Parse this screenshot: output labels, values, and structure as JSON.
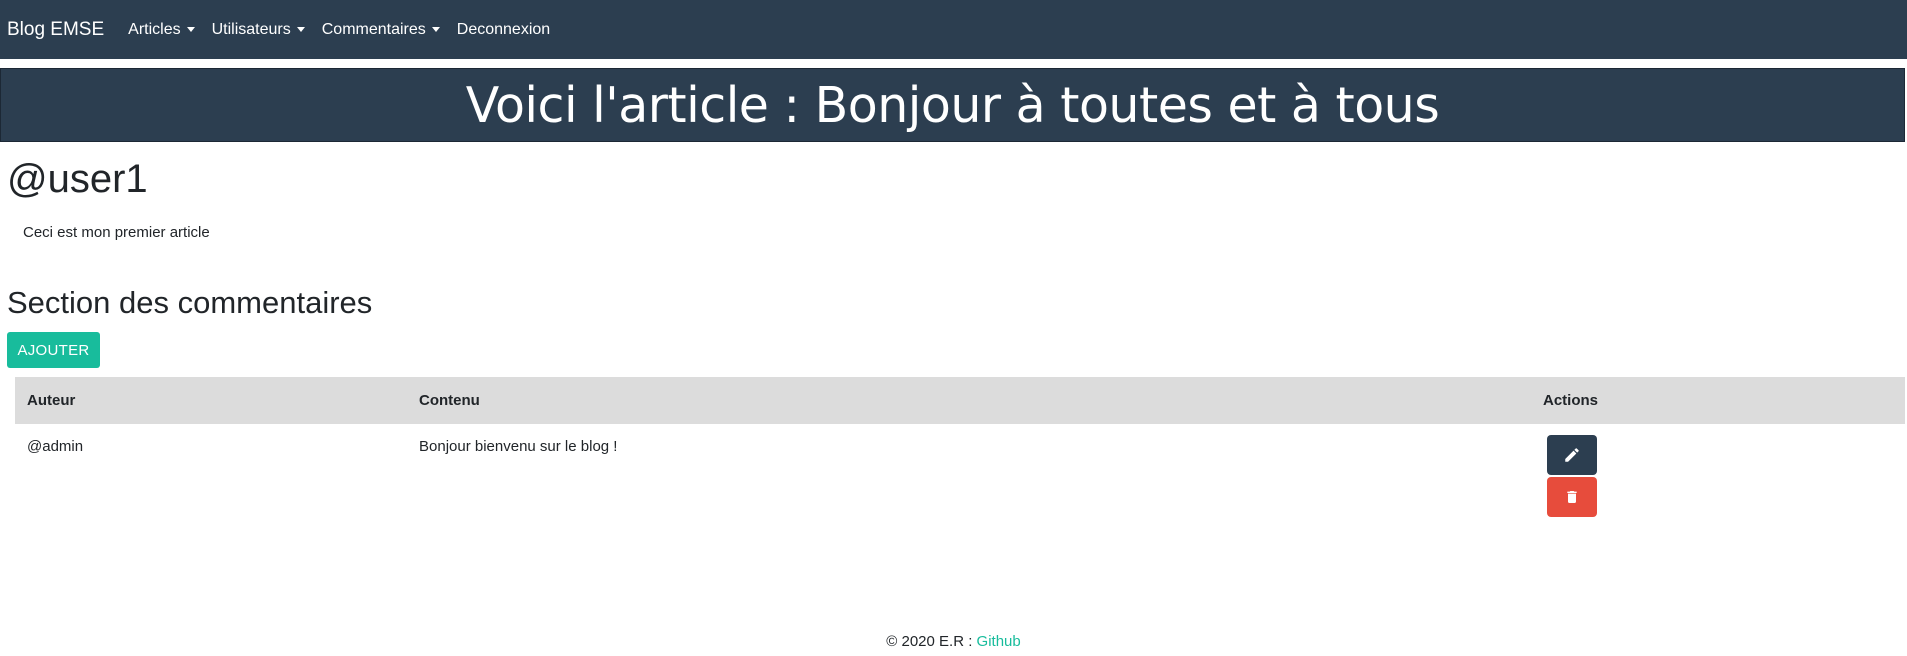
{
  "navbar": {
    "brand": "Blog EMSE",
    "items": [
      {
        "label": "Articles",
        "dropdown": true
      },
      {
        "label": "Utilisateurs",
        "dropdown": true
      },
      {
        "label": "Commentaires",
        "dropdown": true
      },
      {
        "label": "Deconnexion",
        "dropdown": false
      }
    ]
  },
  "hero": {
    "title": "Voici l'article : Bonjour à toutes et à tous"
  },
  "article": {
    "author": "@user1",
    "content": "Ceci est mon premier article"
  },
  "comments": {
    "section_title": "Section des commentaires",
    "add_label": "AJOUTER",
    "headers": [
      "Auteur",
      "Contenu",
      "Actions"
    ],
    "rows": [
      {
        "author": "@admin",
        "content": "Bonjour bienvenu sur le blog !",
        "actions": [
          "pencil-icon",
          "trash-icon"
        ]
      }
    ]
  },
  "footer": {
    "text": "© 2020 E.R : ",
    "link": "Github"
  },
  "colors": {
    "primary": "#2c3e50",
    "success": "#18bc9c",
    "danger": "#e74c3c",
    "table_header": "#dcdcdc"
  }
}
